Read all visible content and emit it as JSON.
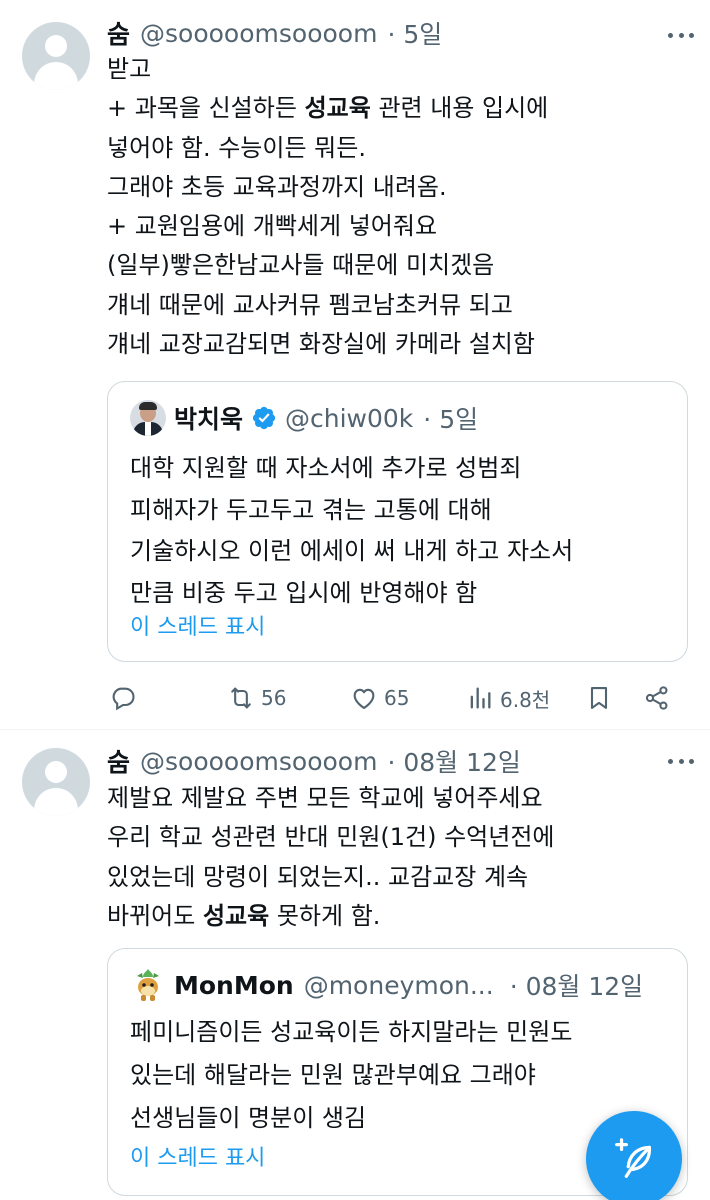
{
  "tweets": [
    {
      "author": "숨",
      "handle": "@sooooomsoooom",
      "time": "· 5일",
      "lines": [
        [
          {
            "t": "받고"
          }
        ],
        [
          {
            "t": "+ 과목을 신설하든 "
          },
          {
            "t": "성교육",
            "b": true
          },
          {
            "t": " 관련 내용 입시에"
          }
        ],
        [
          {
            "t": "넣어야 함. 수능이든 뭐든."
          }
        ],
        [
          {
            "t": "그래야 초등 교육과정까지 내려옴."
          }
        ],
        [
          {
            "t": "+ 교원임용에 개빡세게 넣어줘요"
          }
        ],
        [
          {
            "t": "(일부)빻은한남교사들 때문에 미치겠음"
          }
        ],
        [
          {
            "t": "걔네 때문에 교사커뮤 펨코남초커뮤 되고"
          }
        ],
        [
          {
            "t": "걔네 교장교감되면 화장실에 카메라 설치함"
          }
        ]
      ],
      "quote": {
        "name": "박치욱",
        "handle": "@chiw00k",
        "time": "· 5일",
        "avatar_icon": "person-avatar",
        "verified": true,
        "lines": [
          "대학 지원할 때 자소서에 추가로 성범죄",
          "피해자가 두고두고 겪는 고통에 대해",
          "기술하시오 이런 에세이 써 내게 하고 자소서",
          "만큼 비중 두고 입시에 반영해야 함"
        ],
        "thread_link": "이 스레드 표시"
      },
      "actions": {
        "reply": "",
        "retweet": "56",
        "like": "65",
        "views": "6.8천"
      }
    },
    {
      "author": "숨",
      "handle": "@sooooomsoooom",
      "time": "· 08월 12일",
      "lines": [
        [
          {
            "t": "제발요 제발요 주변 모든 학교에 넣어주세요"
          }
        ],
        [
          {
            "t": "우리 학교 성관련 반대 민원(1건) 수억년전에"
          }
        ],
        [
          {
            "t": "있었는데 망령이 되었는지.. 교감교장 계속"
          }
        ],
        [
          {
            "t": "바뀌어도 "
          },
          {
            "t": "성교육",
            "b": true
          },
          {
            "t": " 못하게 함."
          }
        ]
      ],
      "quote": {
        "name": "MonMon",
        "handle": "@moneymon...",
        "time": "· 08월 12일",
        "avatar_icon": "sprite-avatar",
        "verified": false,
        "lines": [
          "페미니즘이든 성교육이든 하지말라는 민원도",
          "있는데 해달라는 민원 많관부예요 그래야",
          "선생님들이 명분이 생김"
        ],
        "thread_link": "이 스레드 표시"
      }
    }
  ],
  "icons": {
    "reply": "reply-icon",
    "retweet": "retweet-icon",
    "like": "heart-icon",
    "views": "views-icon",
    "bookmark": "bookmark-icon",
    "share": "share-icon",
    "more": "more-icon",
    "compose": "compose-feather-icon"
  },
  "colors": {
    "accent": "#1d9bf0",
    "text": "#0f1419",
    "secondary": "#536471",
    "border": "#cfd9de"
  }
}
